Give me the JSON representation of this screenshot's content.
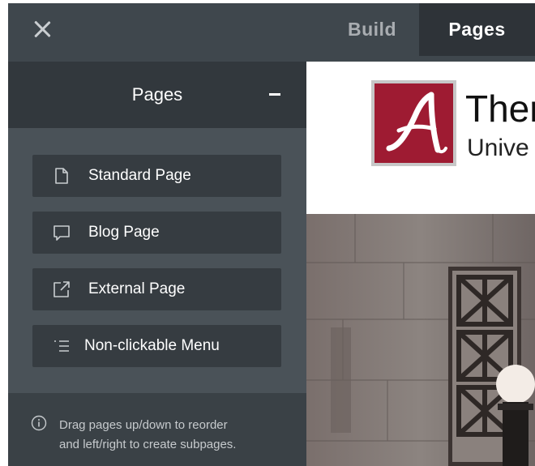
{
  "topbar": {
    "tabs": [
      {
        "label": "Build"
      },
      {
        "label": "Pages"
      }
    ],
    "active_tab": "Pages"
  },
  "sidebar": {
    "title": "Pages",
    "items": [
      {
        "label": "Standard Page",
        "icon": "page-icon"
      },
      {
        "label": "Blog Page",
        "icon": "chat-bubble-icon"
      },
      {
        "label": "External Page",
        "icon": "external-link-icon"
      },
      {
        "label": "Non-clickable Menu",
        "icon": "menu-list-icon"
      }
    ],
    "hint_line1": "Drag pages up/down to reorder",
    "hint_line2": "and left/right to create subpages."
  },
  "preview": {
    "title_partial": "Ther",
    "subtitle_partial": "Unive",
    "logo_color": "#9e1b32"
  },
  "colors": {
    "topbar": "#3f474d",
    "active_tab": "#2e3338",
    "sidebar": "#4a5258",
    "button": "#363c41"
  }
}
